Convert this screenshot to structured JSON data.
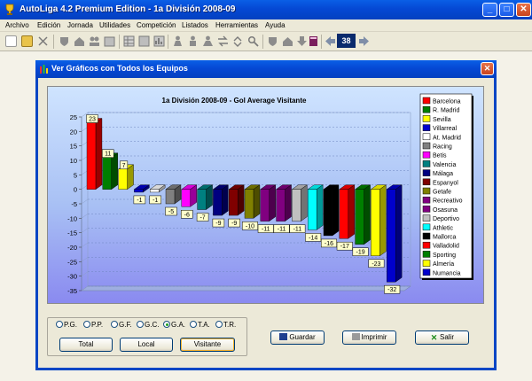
{
  "app": {
    "title": "AutoLiga 4.2 Premium Edition - 1a División 2008-09"
  },
  "window_controls": {
    "minimize": "_",
    "maximize": "□",
    "close": "✕"
  },
  "menu": [
    "Archivo",
    "Edición",
    "Jornada",
    "Utilidades",
    "Competición",
    "Listados",
    "Herramientas",
    "Ayuda"
  ],
  "toolbar": {
    "round_number": "38",
    "icons": [
      "new-icon",
      "open-icon",
      "cut-icon",
      "shield-icon",
      "home-icon",
      "team-icon",
      "calendar-icon",
      "table-icon",
      "player-icon",
      "referee-icon",
      "ball-icon",
      "book-icon",
      "back-arrow-icon",
      "forward-arrow-icon"
    ]
  },
  "dialog": {
    "title": "Ver Gráficos con Todos los Equipos",
    "close": "✕",
    "options": [
      {
        "label": "P.G.",
        "selected": false
      },
      {
        "label": "P.P.",
        "selected": false
      },
      {
        "label": "G.F.",
        "selected": false
      },
      {
        "label": "G.C.",
        "selected": false
      },
      {
        "label": "G.A.",
        "selected": true
      },
      {
        "label": "T.A.",
        "selected": false
      },
      {
        "label": "T.R.",
        "selected": false
      }
    ],
    "buttons": {
      "total": "Total",
      "local": "Local",
      "visitante": "Visitante",
      "guardar": "Guardar",
      "imprimir": "Imprimir",
      "salir": "Salir"
    }
  },
  "chart_data": {
    "type": "bar",
    "title": "1a División 2008-09 - Gol Average Visitante",
    "categories": [
      "Barcelona",
      "R. Madrid",
      "Sevilla",
      "Villarreal",
      "At. Madrid",
      "Racing",
      "Betis",
      "Valencia",
      "Málaga",
      "Espanyol",
      "Getafe",
      "Recreativo",
      "Osasuna",
      "Deportivo",
      "Athletic",
      "Mallorca",
      "Valladolid",
      "Sporting",
      "Almería",
      "Numancia"
    ],
    "values": [
      23,
      11,
      7,
      -1,
      -1,
      -5,
      -6,
      -7,
      -9,
      -9,
      -10,
      -11,
      -11,
      -11,
      -14,
      -16,
      -17,
      -19,
      -23,
      -32
    ],
    "colors": [
      "#ff0000",
      "#007f00",
      "#ffff00",
      "#0000cc",
      "#ffffff",
      "#808080",
      "#ff00ff",
      "#008080",
      "#000080",
      "#800000",
      "#808000",
      "#800080",
      "#800080",
      "#c0c0c0",
      "#00ffff",
      "#000000",
      "#ff0000",
      "#007f00",
      "#ffff00",
      "#0000cc"
    ],
    "ylim": [
      -35,
      25
    ],
    "yticks": [
      25,
      20,
      15,
      10,
      5,
      0,
      -5,
      -10,
      -15,
      -20,
      -25,
      -30,
      -35
    ],
    "grid": true,
    "legend": "right"
  }
}
